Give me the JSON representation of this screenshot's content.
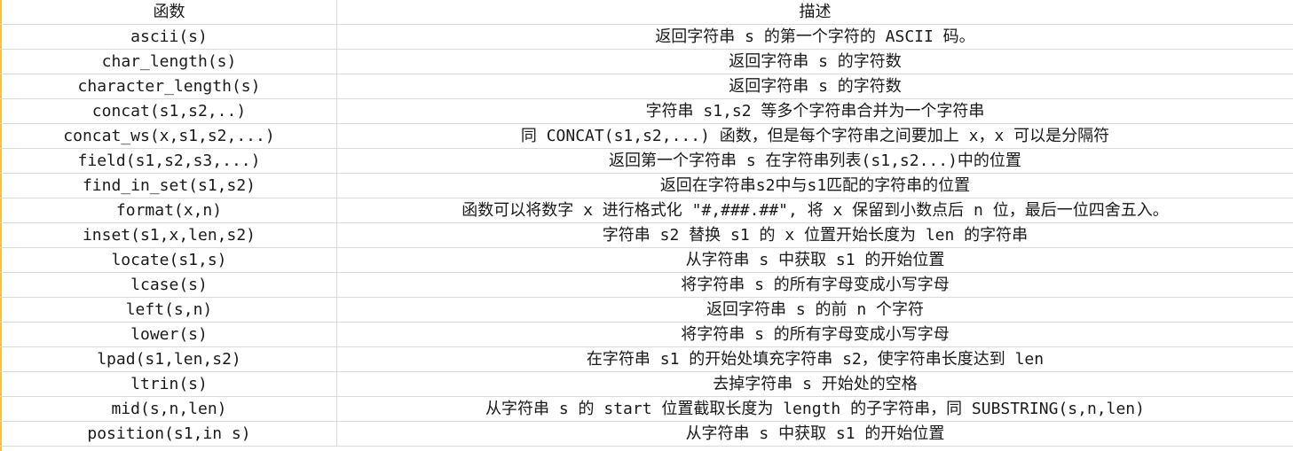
{
  "sheet": {
    "header": {
      "func": "函数",
      "desc": "描述"
    },
    "rows": [
      {
        "func": "ascii(s)",
        "desc": "返回字符串 s 的第一个字符的 ASCII 码。"
      },
      {
        "func": "char_length(s)",
        "desc": "返回字符串 s 的字符数"
      },
      {
        "func": "character_length(s)",
        "desc": "返回字符串 s 的字符数"
      },
      {
        "func": "concat(s1,s2,..)",
        "desc": "字符串 s1,s2 等多个字符串合并为一个字符串"
      },
      {
        "func": "concat_ws(x,s1,s2,...)",
        "desc": "同 CONCAT(s1,s2,...) 函数，但是每个字符串之间要加上 x，x 可以是分隔符"
      },
      {
        "func": "field(s1,s2,s3,...)",
        "desc": "返回第一个字符串 s 在字符串列表(s1,s2...)中的位置"
      },
      {
        "func": "find_in_set(s1,s2)",
        "desc": "返回在字符串s2中与s1匹配的字符串的位置"
      },
      {
        "func": "format(x,n)",
        "desc": "函数可以将数字 x 进行格式化 \"#,###.##\", 将 x 保留到小数点后 n 位，最后一位四舍五入。"
      },
      {
        "func": "inset(s1,x,len,s2)",
        "desc": "字符串 s2 替换 s1 的 x 位置开始长度为 len 的字符串"
      },
      {
        "func": "locate(s1,s)",
        "desc": "从字符串 s 中获取 s1 的开始位置"
      },
      {
        "func": "lcase(s)",
        "desc": "将字符串 s 的所有字母变成小写字母"
      },
      {
        "func": "left(s,n)",
        "desc": "返回字符串 s 的前 n 个字符"
      },
      {
        "func": "lower(s)",
        "desc": "将字符串 s 的所有字母变成小写字母"
      },
      {
        "func": "lpad(s1,len,s2)",
        "desc": "在字符串 s1 的开始处填充字符串 s2，使字符串长度达到 len"
      },
      {
        "func": "ltrin(s)",
        "desc": "去掉字符串 s 开始处的空格"
      },
      {
        "func": "mid(s,n,len)",
        "desc": "从字符串 s 的 start 位置截取长度为 length 的子字符串，同 SUBSTRING(s,n,len)"
      },
      {
        "func": "position(s1,in s)",
        "desc": "从字符串 s 中获取 s1 的开始位置"
      }
    ]
  }
}
